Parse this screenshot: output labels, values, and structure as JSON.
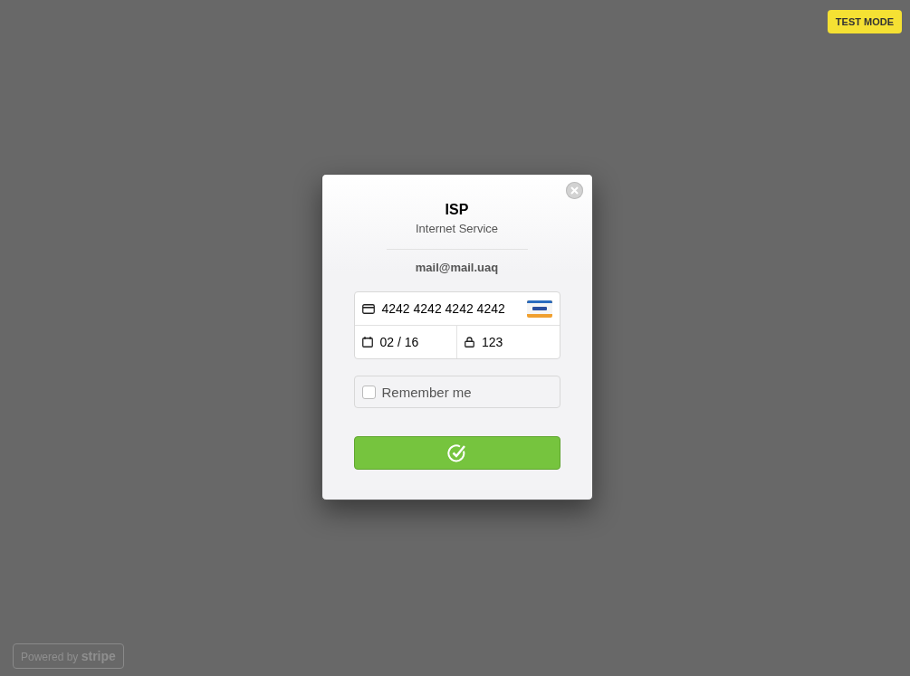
{
  "badge": {
    "label": "TEST MODE"
  },
  "modal": {
    "title": "ISP",
    "subtitle": "Internet Service",
    "email": "mail@mail.uaq",
    "card_number": "4242 4242 4242 4242",
    "expiry": "02 / 16",
    "cvc": "123",
    "remember": {
      "label": "Remember me",
      "checked": false
    }
  },
  "footer": {
    "label": "Powered by **stripe**"
  }
}
